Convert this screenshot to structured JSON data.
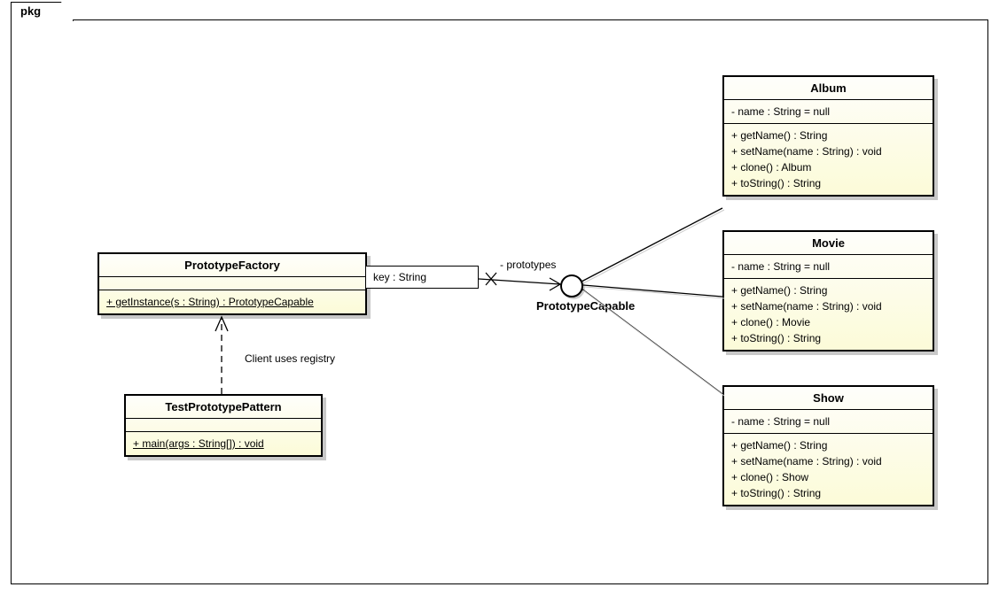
{
  "package_label": "pkg",
  "interface": {
    "name": "PrototypeCapable"
  },
  "assoc": {
    "qualifier": "key : String",
    "rolename": "- prototypes"
  },
  "dependency_label": "Client uses registry",
  "classes": {
    "factory": {
      "name": "PrototypeFactory",
      "ops": [
        "+ getInstance(s : String) : PrototypeCapable"
      ]
    },
    "test": {
      "name": "TestPrototypePattern",
      "ops": [
        "+ main(args : String[]) : void"
      ]
    },
    "album": {
      "name": "Album",
      "attrs": [
        "- name : String = null"
      ],
      "ops": [
        "+ getName() : String",
        "+ setName(name : String) : void",
        "+ clone() : Album",
        "+ toString() : String"
      ]
    },
    "movie": {
      "name": "Movie",
      "attrs": [
        "- name : String = null"
      ],
      "ops": [
        "+ getName() : String",
        "+ setName(name : String) : void",
        "+ clone() : Movie",
        "+ toString() : String"
      ]
    },
    "show": {
      "name": "Show",
      "attrs": [
        "- name : String = null"
      ],
      "ops": [
        "+ getName() : String",
        "+ setName(name : String) : void",
        "+ clone() : Show",
        "+ toString() : String"
      ]
    }
  },
  "chart_data": {
    "type": "uml-class-diagram",
    "package": "pkg",
    "elements": [
      {
        "id": "PrototypeFactory",
        "kind": "class",
        "operations": [
          {
            "signature": "getInstance(s : String) : PrototypeCapable",
            "visibility": "+",
            "static": true
          }
        ]
      },
      {
        "id": "TestPrototypePattern",
        "kind": "class",
        "operations": [
          {
            "signature": "main(args : String[]) : void",
            "visibility": "+",
            "static": true
          }
        ]
      },
      {
        "id": "PrototypeCapable",
        "kind": "interface"
      },
      {
        "id": "Album",
        "kind": "class",
        "attributes": [
          {
            "signature": "name : String = null",
            "visibility": "-"
          }
        ],
        "operations": [
          {
            "signature": "getName() : String",
            "visibility": "+"
          },
          {
            "signature": "setName(name : String) : void",
            "visibility": "+"
          },
          {
            "signature": "clone() : Album",
            "visibility": "+"
          },
          {
            "signature": "toString() : String",
            "visibility": "+"
          }
        ]
      },
      {
        "id": "Movie",
        "kind": "class",
        "attributes": [
          {
            "signature": "name : String = null",
            "visibility": "-"
          }
        ],
        "operations": [
          {
            "signature": "getName() : String",
            "visibility": "+"
          },
          {
            "signature": "setName(name : String) : void",
            "visibility": "+"
          },
          {
            "signature": "clone() : Movie",
            "visibility": "+"
          },
          {
            "signature": "toString() : String",
            "visibility": "+"
          }
        ]
      },
      {
        "id": "Show",
        "kind": "class",
        "attributes": [
          {
            "signature": "name : String = null",
            "visibility": "-"
          }
        ],
        "operations": [
          {
            "signature": "getName() : String",
            "visibility": "+"
          },
          {
            "signature": "setName(name : String) : void",
            "visibility": "+"
          },
          {
            "signature": "clone() : Show",
            "visibility": "+"
          },
          {
            "signature": "toString() : String",
            "visibility": "+"
          }
        ]
      }
    ],
    "relationships": [
      {
        "type": "qualified-association",
        "from": "PrototypeFactory",
        "to": "PrototypeCapable",
        "qualifier": "key : String",
        "roleTo": "- prototypes",
        "navigability": "to"
      },
      {
        "type": "dependency",
        "from": "TestPrototypePattern",
        "to": "PrototypeFactory",
        "label": "Client uses registry"
      },
      {
        "type": "realization",
        "from": "Album",
        "to": "PrototypeCapable"
      },
      {
        "type": "realization",
        "from": "Movie",
        "to": "PrototypeCapable"
      },
      {
        "type": "realization",
        "from": "Show",
        "to": "PrototypeCapable"
      }
    ]
  }
}
